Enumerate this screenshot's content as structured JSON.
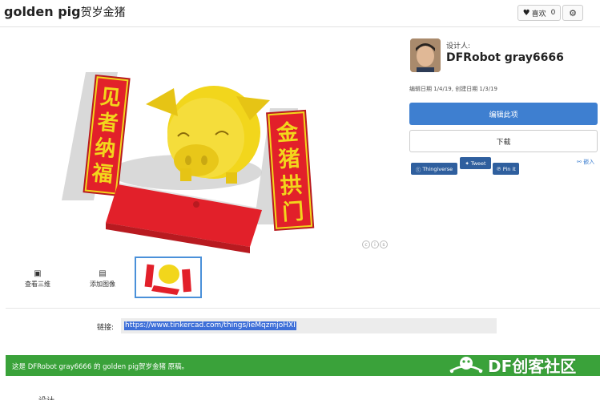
{
  "header": {
    "title": "golden pig",
    "title_suffix": "贺岁金猪",
    "like_label": "喜欢",
    "like_count": "0"
  },
  "designer": {
    "label": "设计人:",
    "name": "DFRobot gray6666",
    "dates": "编辑日期 1/4/19, 创建日期 1/3/19"
  },
  "actions": {
    "edit_label": "编辑此项",
    "download_label": "下载"
  },
  "share": {
    "thingiverse": "Thingiverse",
    "tweet": "Tweet",
    "pinit": "Pin it",
    "embed": "嵌入"
  },
  "thumbs": {
    "view_3d": "查看三维",
    "add_image": "添加图像"
  },
  "model_text": {
    "left_banner": [
      "见",
      "者",
      "纳",
      "福"
    ],
    "right_banner": [
      "金",
      "猪",
      "拱",
      "门"
    ]
  },
  "link": {
    "label": "链接:",
    "url": "https://www.tinkercad.com/things/ieMqzmjoHXI"
  },
  "notice": {
    "text": "这是 DFRobot gray6666 的 golden pig贺岁金猪 原稿。"
  },
  "branding": {
    "logo_text": "DF创客社区"
  },
  "bottom": {
    "partial_text": "设计"
  },
  "colors": {
    "accent": "#3e7fd0",
    "green": "#3aa23a",
    "pig": "#f2d61c",
    "red": "#e2202a"
  },
  "icons": {
    "heart": "heart-icon",
    "gear": "gear-icon",
    "cube": "cube-icon",
    "image": "image-icon",
    "link": "link-icon"
  }
}
